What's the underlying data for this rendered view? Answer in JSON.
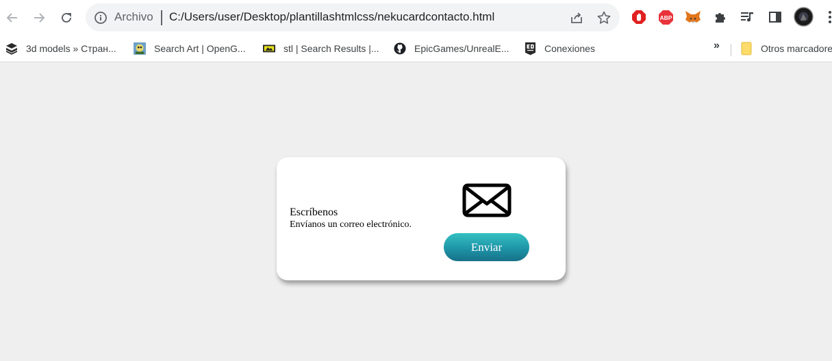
{
  "browser": {
    "omnibox": {
      "security_chip": "Archivo",
      "url": "C:/Users/user/Desktop/plantillashtmlcss/nekucardcontacto.html"
    },
    "extensions": [
      "adblock-stop-icon",
      "abp-icon",
      "metamask-fox-icon",
      "extensions-puzzle-icon",
      "media-control-icon",
      "side-panel-icon",
      "profile-avatar",
      "menu-dots-icon"
    ],
    "extension_labels": {
      "abp": "ABP"
    },
    "bookmarks": [
      {
        "label": "3d models » Стран...",
        "icon": "cube-stack-icon"
      },
      {
        "label": "Search Art | OpenG...",
        "icon": "opengameart-icon"
      },
      {
        "label": "stl | Search Results |...",
        "icon": "stl-icon"
      },
      {
        "label": "EpicGames/UnrealE...",
        "icon": "github-icon"
      },
      {
        "label": "Conexiones",
        "icon": "epic-games-icon"
      }
    ],
    "bookmarks_overflow": "»",
    "other_bookmarks": "Otros marcadores"
  },
  "card": {
    "title": "Escríbenos",
    "text": "Envíanos un correo electrónico.",
    "icon": "envelope-icon",
    "button_label": "Enviar"
  },
  "colors": {
    "page_bg": "#efefef",
    "button_top": "#34c0c0",
    "button_bottom": "#177088"
  }
}
